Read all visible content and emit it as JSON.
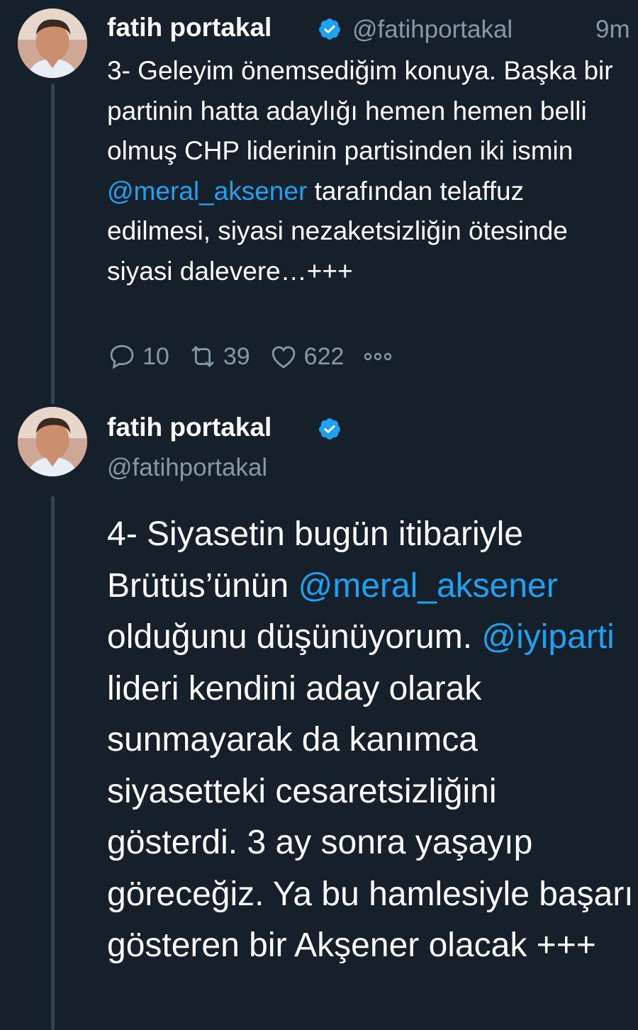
{
  "tweets": [
    {
      "author": {
        "name": "fatih portakal",
        "handle": "@fatihportakal"
      },
      "time": "9m",
      "text_parts": [
        {
          "text": "3- Geleyim önemsediğim konuya. Başka bir partinin hatta adaylığı hemen hemen belli olmuş CHP liderinin partisinden iki ismin ",
          "mention": false
        },
        {
          "text": "@meral_aksener",
          "mention": true
        },
        {
          "text": " tarafından telaffuz edilmesi, siyasi nezaketsizliğin ötesinde siyasi dalevere…+++",
          "mention": false
        }
      ],
      "stats": {
        "replies": "10",
        "retweets": "39",
        "likes": "622"
      }
    },
    {
      "author": {
        "name": "fatih portakal",
        "handle": "@fatihportakal"
      },
      "text_parts": [
        {
          "text": "4- Siyasetin bugün itibariyle Brütüs’ünün ",
          "mention": false
        },
        {
          "text": "@meral_aksener",
          "mention": true
        },
        {
          "text": " olduğunu düşünüyorum. ",
          "mention": false
        },
        {
          "text": "@iyiparti",
          "mention": true
        },
        {
          "text": " lideri kendini aday olarak sunmayarak da kanımca siyasetteki cesaretsizliğini gösterdi. 3 ay sonra yaşayıp göreceğiz. Ya bu hamlesiyle başarı gösteren bir Akşener olacak +++",
          "mention": false
        }
      ]
    }
  ],
  "colors": {
    "background": "#15202b",
    "text": "#ffffff",
    "secondary": "#8899a6",
    "accent": "#1da1f2",
    "thread_line": "#38444d"
  },
  "icons": [
    "verified-badge-icon",
    "reply-icon",
    "retweet-icon",
    "like-icon",
    "more-icon"
  ]
}
